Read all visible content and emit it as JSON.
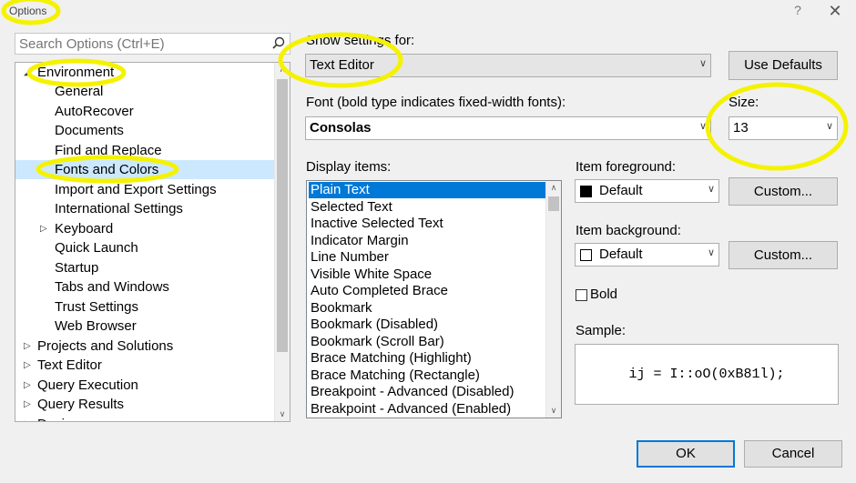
{
  "window": {
    "title": "Options",
    "help_symbol": "?",
    "close_symbol": "✕"
  },
  "search": {
    "placeholder": "Search Options (Ctrl+E)"
  },
  "tree": {
    "items": [
      {
        "label": "Environment",
        "expander": "◢"
      },
      {
        "label": "General"
      },
      {
        "label": "AutoRecover"
      },
      {
        "label": "Documents"
      },
      {
        "label": "Find and Replace"
      },
      {
        "label": "Fonts and Colors",
        "selected": true
      },
      {
        "label": "Import and Export Settings"
      },
      {
        "label": "International Settings"
      },
      {
        "label": "Keyboard",
        "expander": "▷"
      },
      {
        "label": "Quick Launch"
      },
      {
        "label": "Startup"
      },
      {
        "label": "Tabs and Windows"
      },
      {
        "label": "Trust Settings"
      },
      {
        "label": "Web Browser"
      },
      {
        "label": "Projects and Solutions",
        "expander": "▷"
      },
      {
        "label": "Text Editor",
        "expander": "▷"
      },
      {
        "label": "Query Execution",
        "expander": "▷"
      },
      {
        "label": "Query Results",
        "expander": "▷"
      },
      {
        "label": "Designers",
        "expander": "▷"
      }
    ]
  },
  "show_settings": {
    "label": "Show settings for:",
    "value": "Text Editor"
  },
  "use_defaults_label": "Use Defaults",
  "font": {
    "label": "Font (bold type indicates fixed-width fonts):",
    "value": "Consolas"
  },
  "size": {
    "label": "Size:",
    "value": "13"
  },
  "display_items": {
    "label": "Display items:",
    "items": [
      "Plain Text",
      "Selected Text",
      "Inactive Selected Text",
      "Indicator Margin",
      "Line Number",
      "Visible White Space",
      "Auto Completed Brace",
      "Bookmark",
      "Bookmark (Disabled)",
      "Bookmark (Scroll Bar)",
      "Brace Matching (Highlight)",
      "Brace Matching (Rectangle)",
      "Breakpoint - Advanced (Disabled)",
      "Breakpoint - Advanced (Enabled)"
    ],
    "selected_index": 0
  },
  "item_foreground": {
    "label": "Item foreground:",
    "value": "Default",
    "swatch": "#000000",
    "custom_label": "Custom..."
  },
  "item_background": {
    "label": "Item background:",
    "value": "Default",
    "swatch": "#ffffff",
    "custom_label": "Custom..."
  },
  "bold": {
    "label": "Bold",
    "checked": false
  },
  "sample": {
    "label": "Sample:",
    "text": "ij = I::oO(0xB81l);"
  },
  "ok_label": "OK",
  "cancel_label": "Cancel",
  "colors": {
    "accent": "#0078d7",
    "highlight": "#f5f200",
    "tree_selection": "#cce8ff"
  }
}
